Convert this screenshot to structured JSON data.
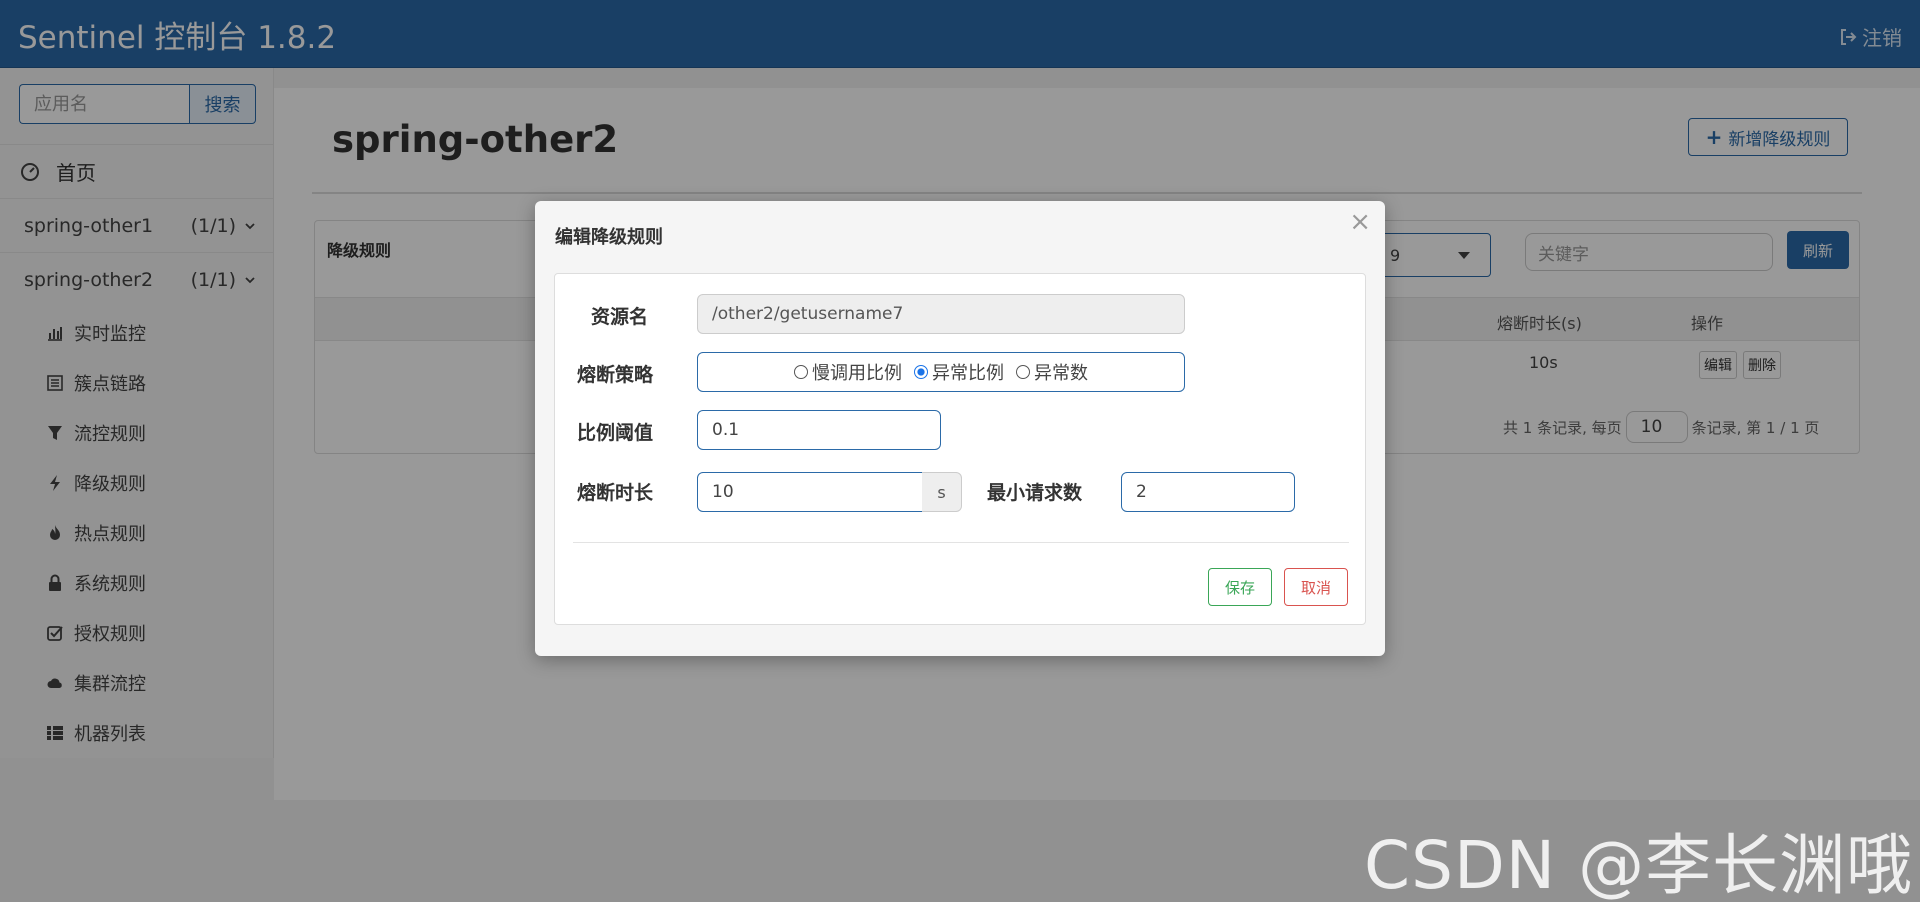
{
  "header": {
    "brand": "Sentinel 控制台 1.8.2",
    "logout_label": "注销"
  },
  "sidebar": {
    "search_placeholder": "应用名",
    "search_button": "搜索",
    "home_label": "首页",
    "apps": [
      {
        "name": "spring-other1",
        "count": "(1/1)"
      },
      {
        "name": "spring-other2",
        "count": "(1/1)"
      }
    ],
    "menu": [
      {
        "label": "实时监控",
        "icon": "bar-chart-icon"
      },
      {
        "label": "簇点链路",
        "icon": "list-icon"
      },
      {
        "label": "流控规则",
        "icon": "filter-icon"
      },
      {
        "label": "降级规则",
        "icon": "flash-icon"
      },
      {
        "label": "热点规则",
        "icon": "fire-icon"
      },
      {
        "label": "系统规则",
        "icon": "lock-icon"
      },
      {
        "label": "授权规则",
        "icon": "check-icon"
      },
      {
        "label": "集群流控",
        "icon": "cloud-icon"
      },
      {
        "label": "机器列表",
        "icon": "th-list-icon"
      }
    ]
  },
  "main": {
    "app_title": "spring-other2",
    "add_button": "新增降级规则",
    "panel_title": "降级规则",
    "machine_select_fragment": "9",
    "keyword_placeholder": "关键字",
    "refresh_button": "刷新",
    "columns": {
      "duration": "熔断时长(s)",
      "action": "操作"
    },
    "row": {
      "duration": "10s",
      "edit": "编辑",
      "delete": "删除"
    },
    "pager": {
      "prefix": "共 1 条记录, 每页",
      "page_size": "10",
      "suffix": "条记录, 第 1 / 1 页"
    }
  },
  "modal": {
    "title": "编辑降级规则",
    "close": "×",
    "resource_label": "资源名",
    "resource_value": "/other2/getusername7",
    "strategy_label": "熔断策略",
    "strategies": [
      {
        "label": "慢调用比例",
        "selected": false
      },
      {
        "label": "异常比例",
        "selected": true
      },
      {
        "label": "异常数",
        "selected": false
      }
    ],
    "ratio_label": "比例阈值",
    "ratio_value": "0.1",
    "duration_label": "熔断时长",
    "duration_value": "10",
    "duration_unit": "s",
    "min_request_label": "最小请求数",
    "min_request_value": "2",
    "save_button": "保存",
    "cancel_button": "取消"
  },
  "watermark": "CSDN @李长渊哦",
  "colors": {
    "primary": "#2b6aa8",
    "save": "#3aa657",
    "cancel": "#d9534f"
  }
}
